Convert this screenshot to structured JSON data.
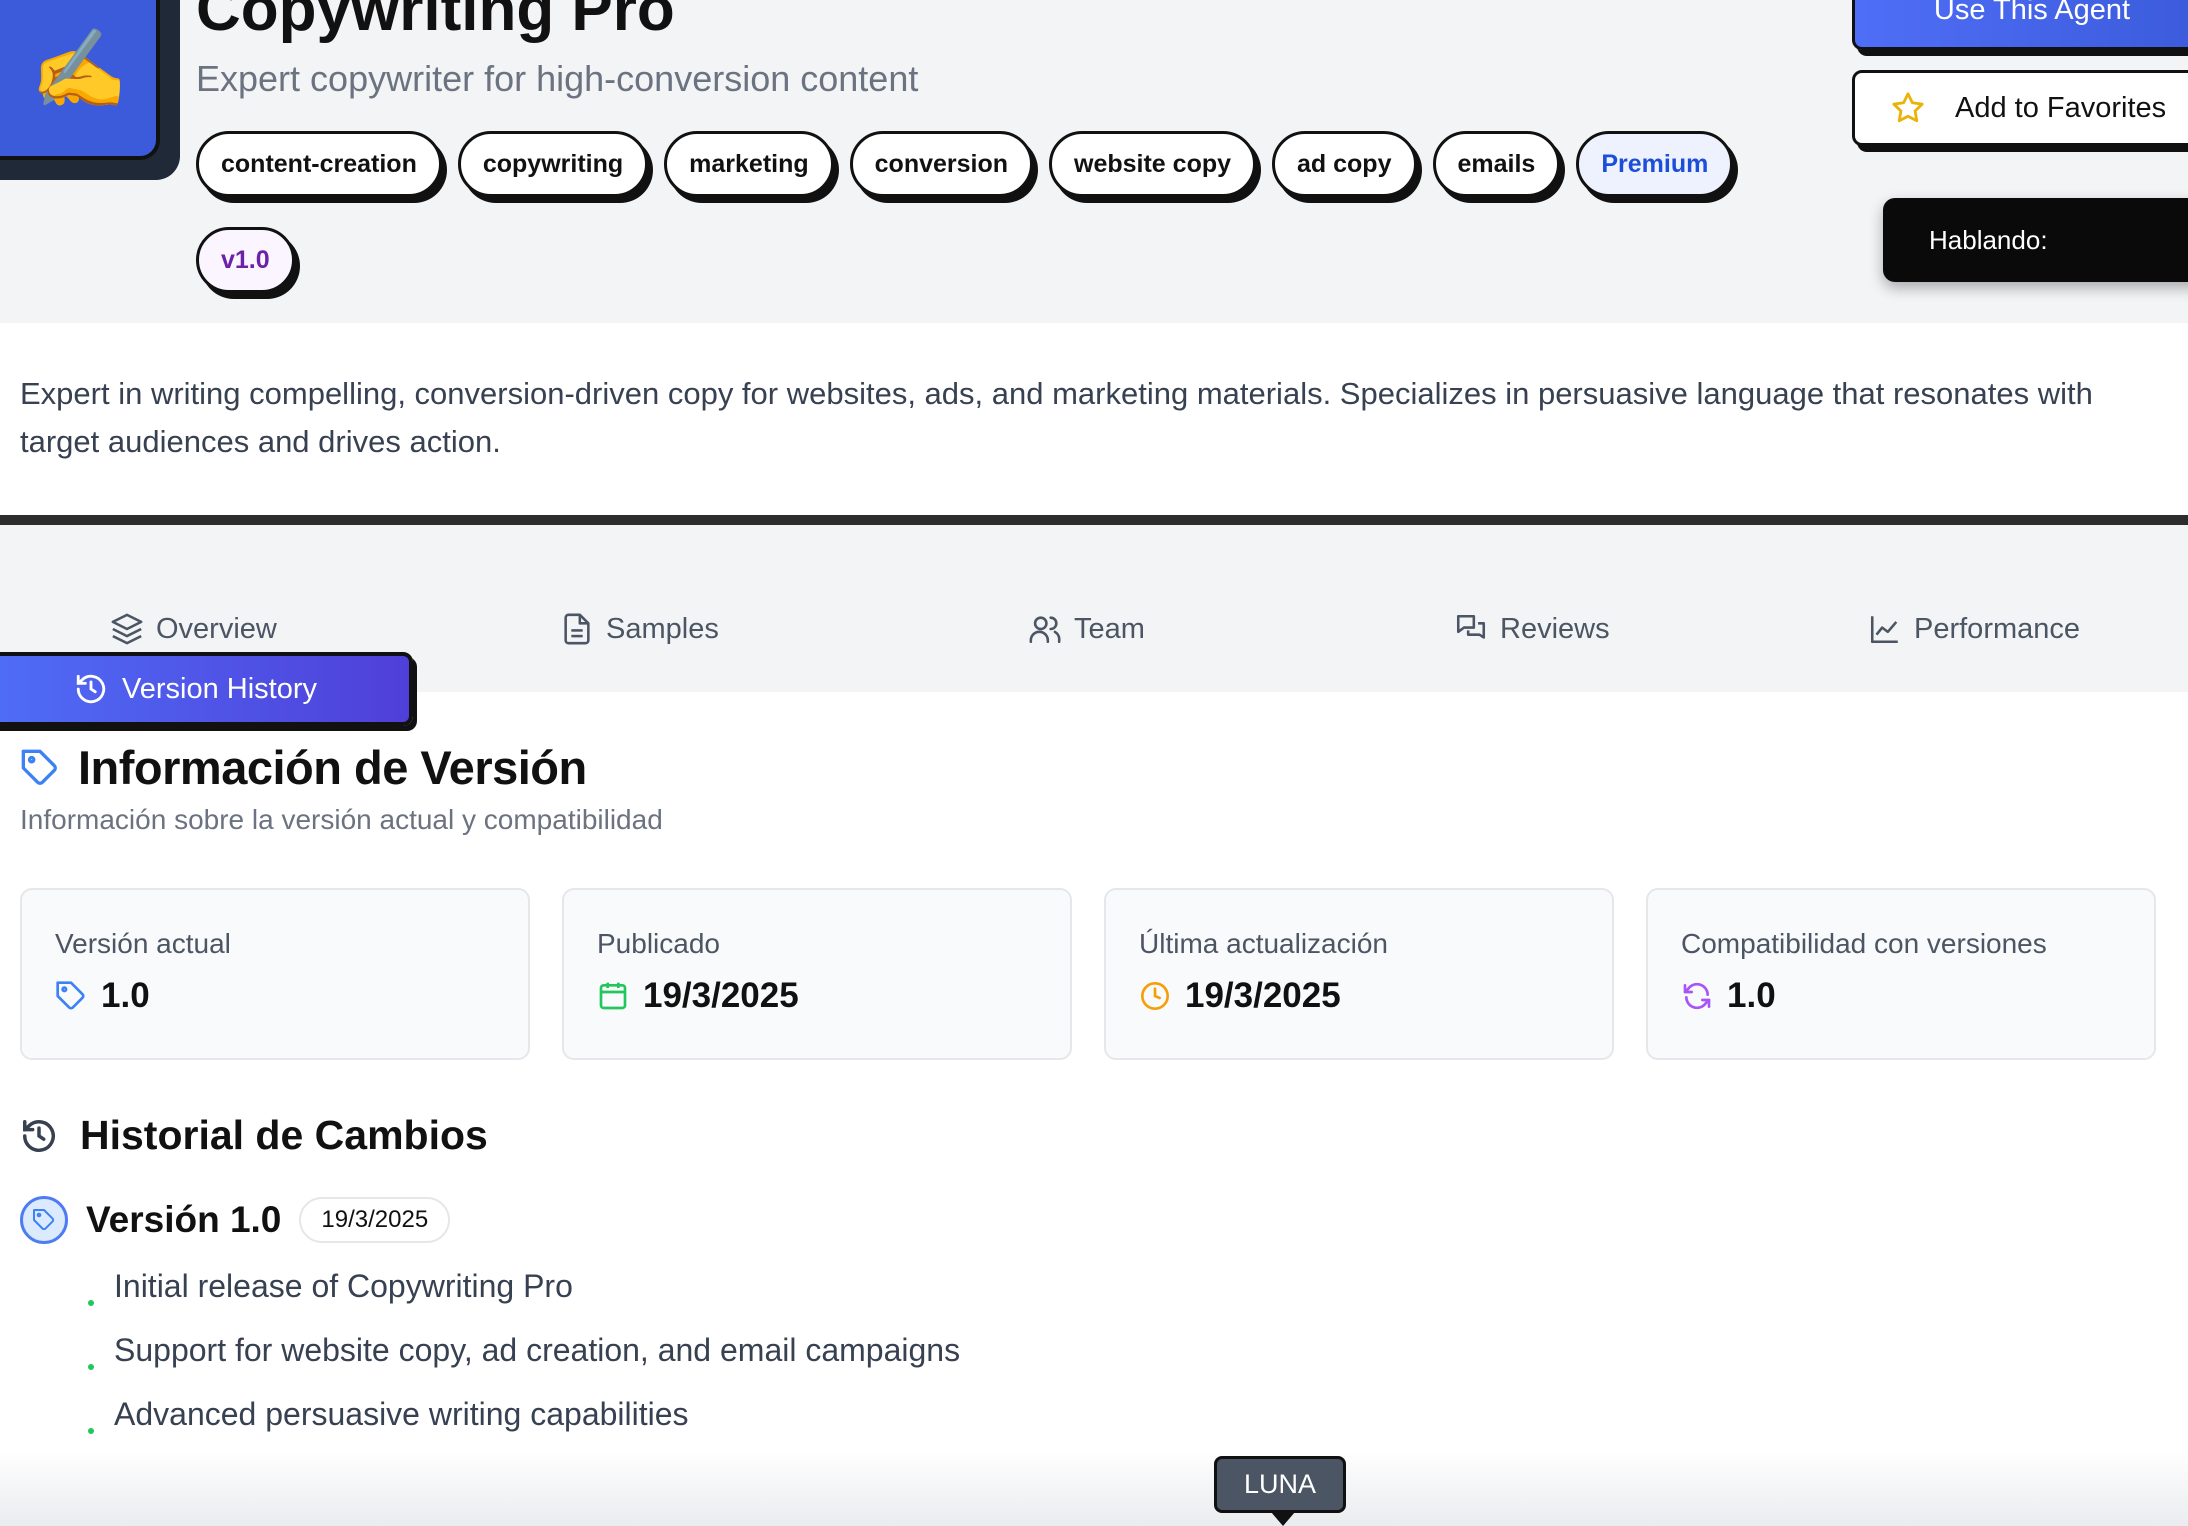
{
  "header": {
    "avatar_emoji": "✍️",
    "title": "Copywriting Pro",
    "subtitle": "Expert copywriter for high-conversion content",
    "tags": [
      "content-creation",
      "copywriting",
      "marketing",
      "conversion",
      "website copy",
      "ad copy",
      "emails"
    ],
    "premium_badge": "Premium",
    "version_badge": "v1.0",
    "use_agent_label": "Use This Agent",
    "favorites_label": "Add to Favorites",
    "speaking_label": "Hablando:"
  },
  "description": "Expert in writing compelling, conversion-driven copy for websites, ads, and marketing materials. Specializes in persuasive language that resonates with target audiences and drives action.",
  "tabs": {
    "overview": "Overview",
    "samples": "Samples",
    "team": "Team",
    "reviews": "Reviews",
    "performance": "Performance",
    "version_history": "Version History"
  },
  "version_info": {
    "heading": "Información de Versión",
    "subheading": "Información sobre la versión actual y compatibilidad",
    "cards": [
      {
        "label": "Versión actual",
        "value": "1.0",
        "icon": "tag-icon",
        "color": "#3b82f6"
      },
      {
        "label": "Publicado",
        "value": "19/3/2025",
        "icon": "calendar-icon",
        "color": "#22c55e"
      },
      {
        "label": "Última actualización",
        "value": "19/3/2025",
        "icon": "clock-icon",
        "color": "#f59e0b"
      },
      {
        "label": "Compatibilidad con versiones",
        "value": "1.0",
        "icon": "refresh-icon",
        "color": "#a855f7"
      }
    ]
  },
  "history": {
    "heading": "Historial de Cambios",
    "versions": [
      {
        "title": "Versión 1.0",
        "date": "19/3/2025",
        "changes": [
          "Initial release of Copywriting Pro",
          "Support for website copy, ad creation, and email campaigns",
          "Advanced persuasive writing capabilities"
        ]
      }
    ]
  },
  "assistant_label": "LUNA",
  "colors": {
    "accent": "#4f6ef7",
    "accent_dark": "#4f3fd9",
    "premium_text": "#1d4ed8",
    "version_text": "#6b21a8",
    "bullet": "#22c55e"
  }
}
